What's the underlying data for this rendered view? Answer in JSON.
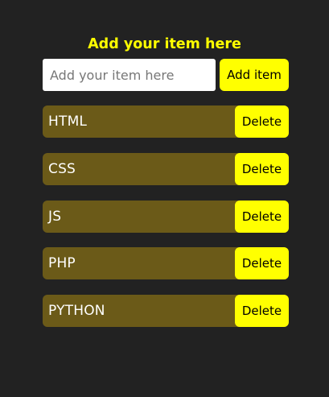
{
  "header": {
    "title": "Add your item here"
  },
  "form": {
    "input_value": "",
    "input_placeholder": "Add your item here",
    "add_button_label": "Add item"
  },
  "list": {
    "items": [
      {
        "label": "HTML",
        "delete_label": "Delete"
      },
      {
        "label": "CSS",
        "delete_label": "Delete"
      },
      {
        "label": "JS",
        "delete_label": "Delete"
      },
      {
        "label": "PHP",
        "delete_label": "Delete"
      },
      {
        "label": "PYTHON",
        "delete_label": "Delete"
      }
    ]
  },
  "colors": {
    "background": "#222222",
    "accent": "#ffff00",
    "item_background": "#6b5a18",
    "item_text": "#ffffff"
  }
}
